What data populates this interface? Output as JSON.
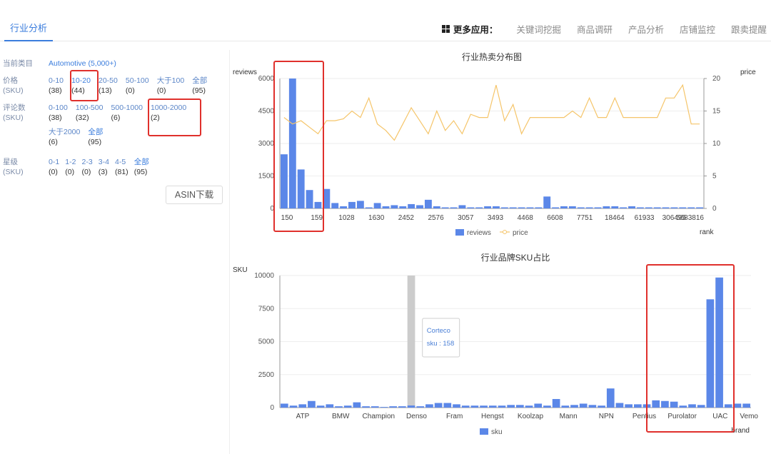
{
  "header": {
    "active_tab": "行业分析",
    "more_apps_label": "更多应用：",
    "apps": [
      "关键词挖掘",
      "商品调研",
      "产品分析",
      "店铺监控",
      "跟卖提醒"
    ]
  },
  "filters": {
    "category": {
      "label": "当前类目",
      "value": "Automotive (5,000+)"
    },
    "price": {
      "label": "价格",
      "sub": "(SKU)",
      "options": [
        {
          "label": "0-10",
          "count": "(38)"
        },
        {
          "label": "10-20",
          "count": "(44)"
        },
        {
          "label": "20-50",
          "count": "(13)"
        },
        {
          "label": "50-100",
          "count": "(0)"
        },
        {
          "label": "大于100",
          "count": "(0)"
        },
        {
          "label": "全部",
          "count": "(95)"
        }
      ]
    },
    "reviews": {
      "label": "评论数",
      "sub": "(SKU)",
      "options": [
        {
          "label": "0-100",
          "count": "(38)"
        },
        {
          "label": "100-500",
          "count": "(32)"
        },
        {
          "label": "500-1000",
          "count": "(6)"
        },
        {
          "label": "1000-2000",
          "count": "(2)"
        },
        {
          "label": "大于2000",
          "count": "(6)"
        },
        {
          "label": "全部",
          "count": "(95)"
        }
      ]
    },
    "stars": {
      "label": "星级",
      "sub": "(SKU)",
      "options": [
        {
          "label": "0-1",
          "count": "(0)"
        },
        {
          "label": "1-2",
          "count": "(0)"
        },
        {
          "label": "2-3",
          "count": "(0)"
        },
        {
          "label": "3-4",
          "count": "(3)"
        },
        {
          "label": "4-5",
          "count": "(81)"
        },
        {
          "label": "全部",
          "count": "(95)"
        }
      ]
    },
    "asin_button": "ASIN下载"
  },
  "chart_data": [
    {
      "type": "bar",
      "title": "行业热卖分布图",
      "xlabel": "rank",
      "ylabel": "reviews",
      "y2label": "price",
      "ylim": [
        0,
        6000
      ],
      "y2lim": [
        0,
        20
      ],
      "yticks": [
        0,
        1500,
        3000,
        4500,
        6000
      ],
      "y2ticks": [
        0,
        5,
        10,
        15,
        20
      ],
      "xtick_labels": [
        "150",
        "159",
        "1028",
        "1630",
        "2452",
        "2576",
        "3057",
        "3493",
        "4468",
        "6608",
        "7751",
        "18464",
        "61933",
        "306495",
        "5683816"
      ],
      "legend": [
        "reviews",
        "price"
      ],
      "colors": {
        "bar": "#5b87e8",
        "line": "#f5c56a"
      },
      "series": [
        {
          "name": "reviews",
          "type": "bar",
          "values": [
            2500,
            6000,
            1800,
            850,
            300,
            900,
            250,
            100,
            300,
            350,
            50,
            250,
            100,
            150,
            100,
            200,
            150,
            400,
            100,
            50,
            50,
            150,
            50,
            50,
            100,
            100,
            50,
            50,
            50,
            50,
            50,
            550,
            50,
            100,
            100,
            50,
            50,
            50,
            100,
            100,
            50,
            100,
            50,
            50,
            50,
            50,
            50,
            50,
            50,
            50
          ]
        },
        {
          "name": "price",
          "type": "line",
          "values": [
            14,
            13,
            13.5,
            12.5,
            11.5,
            13.5,
            13.5,
            13.8,
            15,
            14,
            17,
            13,
            12,
            10.5,
            13,
            15.5,
            13.5,
            11.5,
            15,
            12,
            13.5,
            11.5,
            14.5,
            14,
            14,
            19,
            13.5,
            16,
            11.5,
            14,
            14,
            14,
            14,
            14,
            15,
            14,
            17,
            14,
            14,
            17,
            14,
            14,
            14,
            14,
            14,
            17,
            17,
            19,
            13,
            13
          ]
        }
      ]
    },
    {
      "type": "bar",
      "title": "行业品牌SKU占比",
      "xlabel": "brand",
      "ylabel": "SKU",
      "ylim": [
        0,
        10000
      ],
      "yticks": [
        0,
        2500,
        5000,
        7500,
        10000
      ],
      "xtick_labels": [
        "ATP",
        "BMW",
        "Champion",
        "Denso",
        "Fram",
        "Hengst",
        "Koolzap",
        "Mann",
        "NPN",
        "Pentius",
        "Purolator",
        "UAC",
        "Vemo"
      ],
      "legend": [
        "sku"
      ],
      "colors": {
        "bar": "#5b87e8",
        "highlight": "#cccccc"
      },
      "highlight_index": 14,
      "tooltip": {
        "name": "Corteco",
        "value_label": "sku : 158"
      },
      "series": [
        {
          "name": "sku",
          "values": [
            300,
            150,
            250,
            500,
            150,
            250,
            100,
            150,
            400,
            100,
            100,
            50,
            100,
            100,
            158,
            100,
            250,
            350,
            350,
            250,
            150,
            150,
            150,
            150,
            150,
            200,
            200,
            150,
            300,
            150,
            650,
            150,
            200,
            300,
            200,
            150,
            1450,
            350,
            250,
            250,
            250,
            550,
            500,
            450,
            150,
            250,
            200,
            8200,
            9850,
            250,
            300,
            300
          ]
        }
      ]
    }
  ]
}
